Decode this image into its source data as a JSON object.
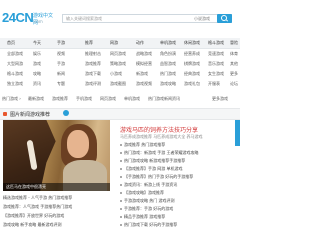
{
  "header": {
    "logo_number": "24CN",
    "logo_word": "游戏中文网",
    "logo_url": ".com",
    "search_placeholder": "输入关键词搜索游戏",
    "search_category": "小说游戏"
  },
  "nav": {
    "rows": [
      [
        "首页",
        "今天",
        "手游",
        "推荐",
        "网游",
        "动作",
        "单机游戏",
        "休闲游戏",
        "格斗游戏",
        "冒险"
      ],
      [
        "全部游戏",
        "娱乐",
        "视频",
        "推理射击",
        "网页游戏",
        "战略游戏",
        "角色扮演",
        "经营养成",
        "竞速游戏",
        "体育"
      ],
      [
        "大型网游",
        "游戏",
        "手游",
        "游戏推荐",
        "策略游戏",
        "模拟经营",
        "益智游戏",
        "棋牌游戏",
        "音乐游戏",
        "其他"
      ],
      [
        "格斗游戏",
        "攻略",
        "新闻",
        "游戏下载",
        "小游戏",
        "新游戏",
        "热门游戏",
        "经典游戏",
        "女生游戏",
        "更多"
      ],
      [
        "独立游戏",
        "资讯",
        "专题",
        "游戏评测",
        "游戏截图",
        "游戏视频",
        "游戏攻略",
        "游戏礼包",
        "开服表",
        "论坛"
      ]
    ]
  },
  "linkbar": [
    "热门游戏 ›",
    "最新游戏",
    "游戏推荐",
    "手机游戏",
    "网页游戏",
    "单机游戏",
    "热门游戏新闻资讯",
    "更多游戏"
  ],
  "panel": {
    "title": "图片新闻游戏推荐",
    "photo_caption": "这匹马在游戏中很漂亮",
    "headline": "游戏马匹的饲养方法技巧分享",
    "subhead": "马匹养成游戏推荐 马匹养成游戏大全 养马游戏",
    "left_items": [
      "精选游戏推荐 - 人气手游 热门游戏推荐",
      "游戏推荐：人气游戏 手游推荐热门游戏",
      "【游戏推荐】开放世界 好玩的游戏",
      "游戏攻略 新手攻略 最新游戏评测"
    ],
    "right_items": [
      "游戏推荐 热门游戏推荐",
      "热门游戏：新游戏 手游 王者荣耀游戏攻略",
      "热门游戏攻略 新游戏推荐手游推荐",
      "【游戏推荐】手游 网游 单机游戏",
      "【手游推荐】热门手游 好玩的手游推荐",
      "游戏资讯：新游上线 手游资讯",
      "【游戏攻略】游戏推荐",
      "手游游戏攻略 热门 游戏评测",
      "手游推荐：手游 好玩的游戏",
      "精品手游推荐 游戏推荐",
      "热门游戏下载 好玩的手游推荐"
    ]
  },
  "colors": {
    "accent": "#2a9fd8",
    "headline": "#d23a3a",
    "badge": "#ff7a45"
  }
}
